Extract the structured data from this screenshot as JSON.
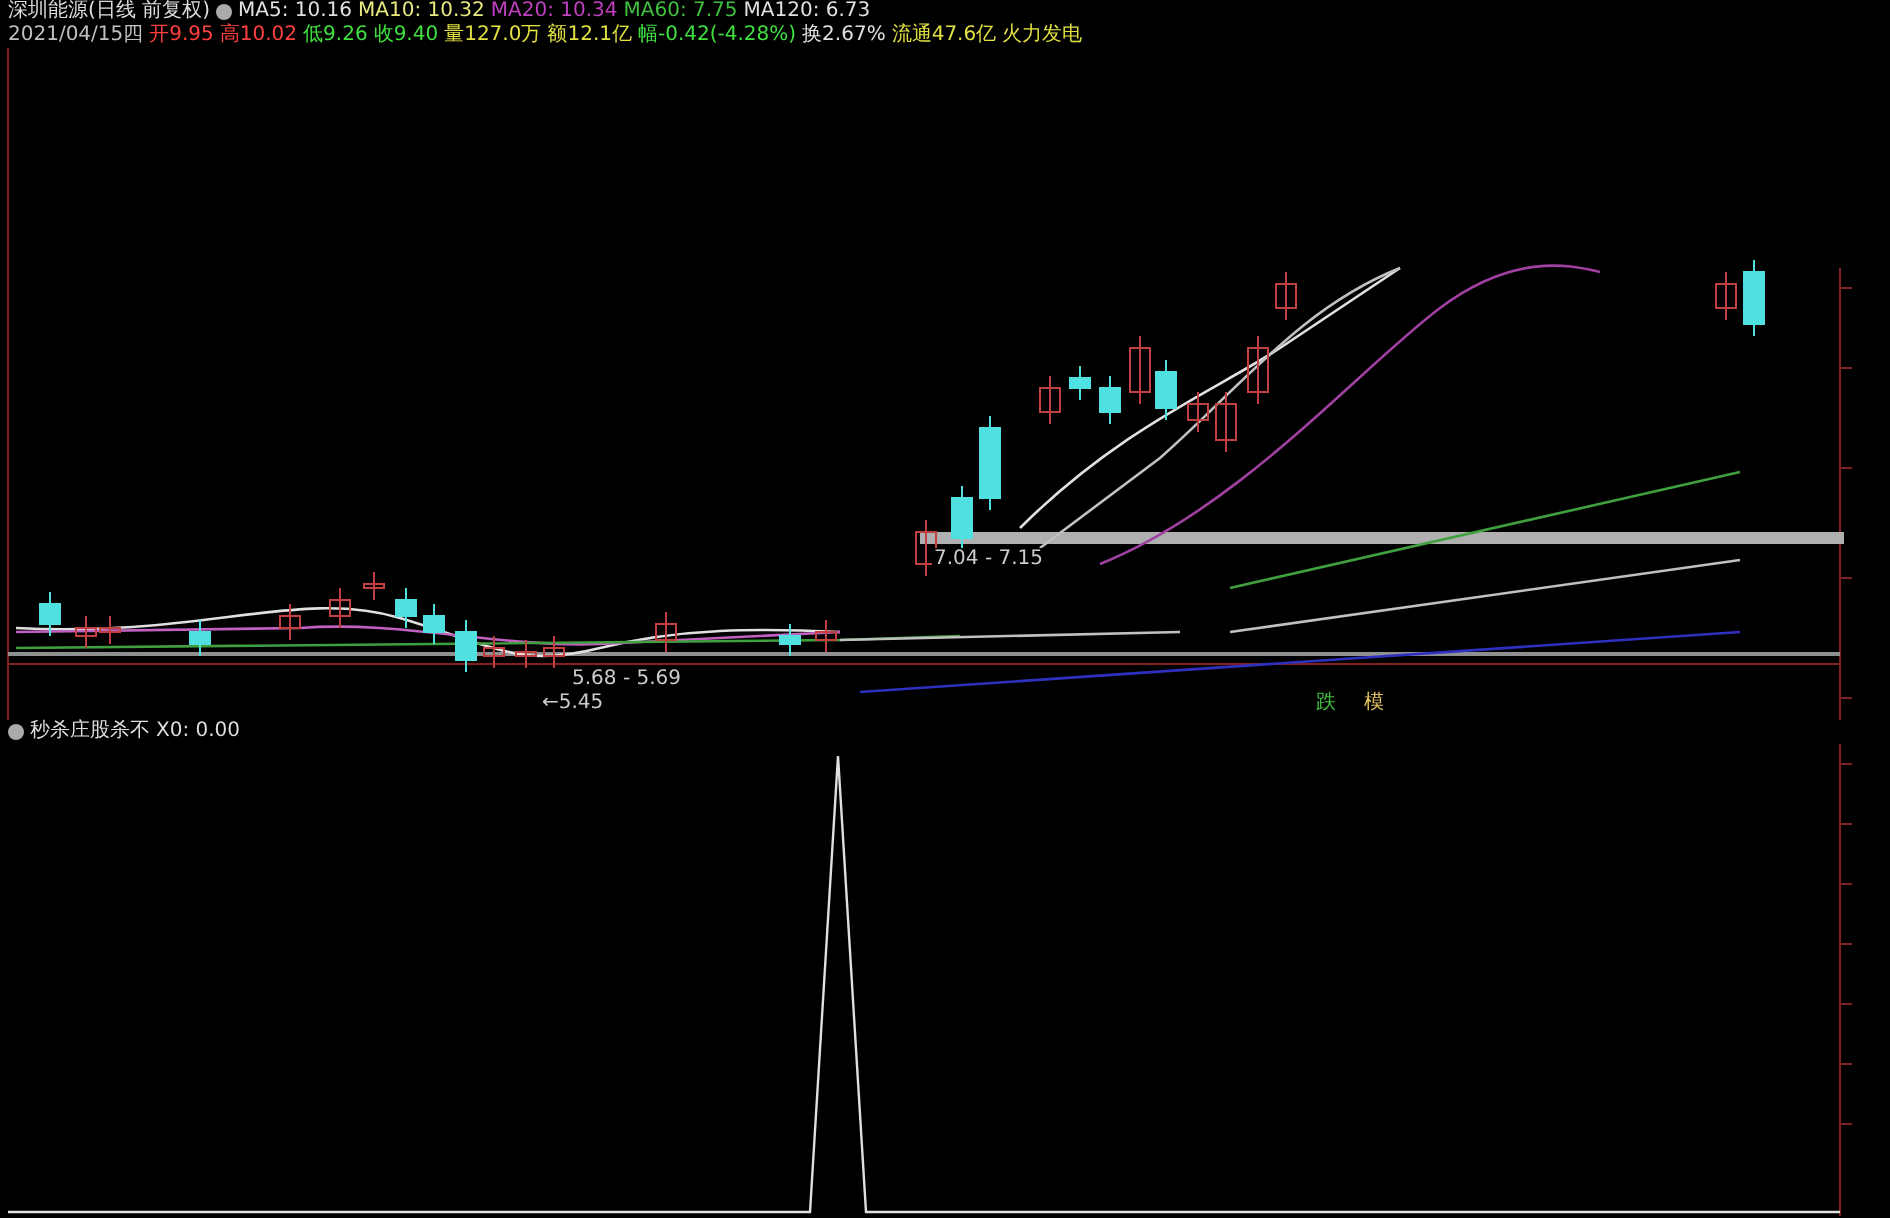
{
  "title_bar": {
    "title": "深圳能源(日线 前复权)",
    "indicators": [
      {
        "text": "MA5: 10.16",
        "color": "#e0e0e0"
      },
      {
        "text": "MA10: 10.32",
        "color": "#e8e880"
      },
      {
        "text": "MA20: 10.34",
        "color": "#c040c0"
      },
      {
        "text": "MA60: 7.75",
        "color": "#40c040"
      },
      {
        "text": "MA120: 6.73",
        "color": "#e0e0e0"
      }
    ]
  },
  "quote_bar": [
    {
      "text": "2021/04/15四",
      "color": "#c0c0c0"
    },
    {
      "text": "开9.95",
      "color": "#ff4040"
    },
    {
      "text": "高10.02",
      "color": "#ff4040"
    },
    {
      "text": "低9.26",
      "color": "#40e040"
    },
    {
      "text": "收9.40",
      "color": "#40e040"
    },
    {
      "text": "量127.0万",
      "color": "#e0e040"
    },
    {
      "text": "额12.1亿",
      "color": "#e0e040"
    },
    {
      "text": "幅-0.42(-4.28%)",
      "color": "#40e040"
    },
    {
      "text": "换2.67%",
      "color": "#e0e0e0"
    },
    {
      "text": "流通47.6亿",
      "color": "#e0e040"
    },
    {
      "text": "火力发电",
      "color": "#e0e040"
    }
  ],
  "price_labels": [
    {
      "text": "7.04 - 7.15"
    },
    {
      "text": "5.68 - 5.69"
    },
    {
      "text": "←5.45"
    }
  ],
  "signal_tags": [
    {
      "text": "跌",
      "color": "#40c040"
    },
    {
      "text": "模",
      "color": "#e0c060"
    }
  ],
  "indicator_pane": {
    "title": "秒杀庄股杀不",
    "reading": "X0: 0.00"
  }
}
